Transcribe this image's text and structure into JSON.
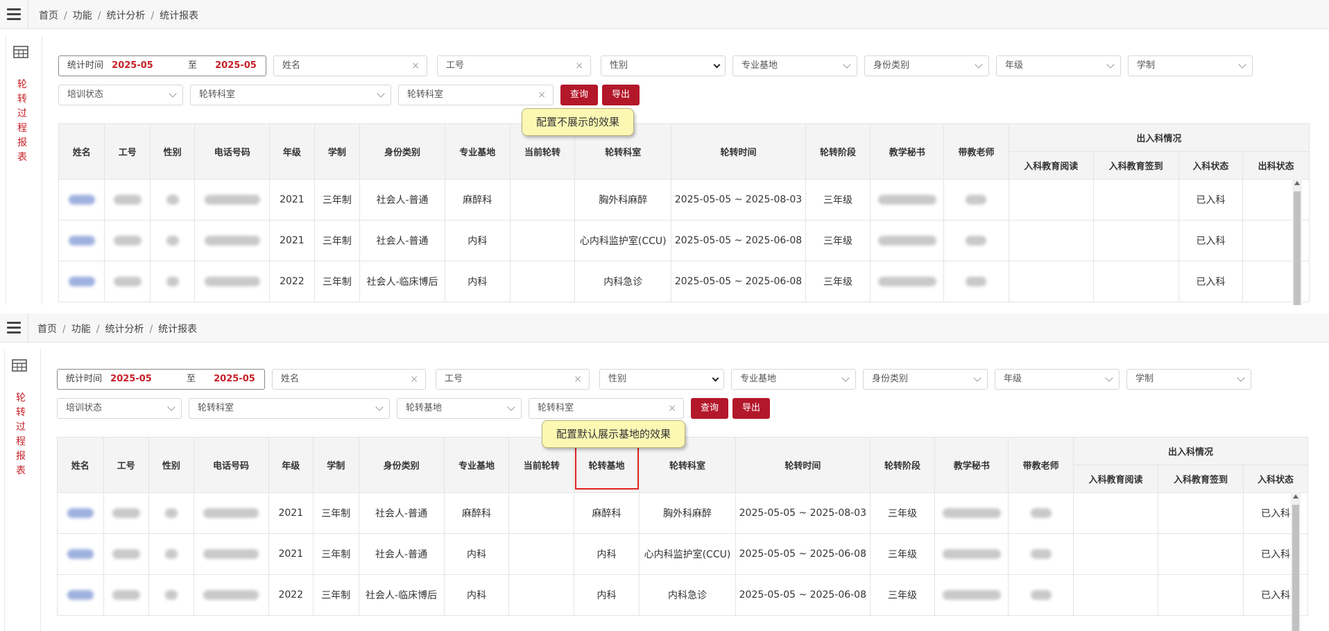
{
  "breadcrumb": [
    "首页",
    "功能",
    "统计分析",
    "统计报表"
  ],
  "side_label": "轮转过程报表",
  "filters": {
    "date_label": "统计时间",
    "date_start": "2025-05",
    "date_to": "至",
    "date_end": "2025-05",
    "name_placeholder": "姓名",
    "workno_placeholder": "工号",
    "gender_placeholder": "性别",
    "major_base": "专业基地",
    "identity": "身份类别",
    "grade": "年级",
    "edu_system": "学制",
    "train_status": "培训状态",
    "rotation_dept": "轮转科室",
    "rotation_base": "轮转基地",
    "rotation_dept_input": "轮转科室",
    "clear": "×",
    "query_button": "查询",
    "export_button": "导出"
  },
  "tooltips": {
    "top": "配置不展示的效果",
    "bottom": "配置默认展示基地的效果"
  },
  "headers": {
    "name": "姓名",
    "workno": "工号",
    "gender": "性别",
    "phone": "电话号码",
    "grade": "年级",
    "system": "学制",
    "identity": "身份类别",
    "major_base": "专业基地",
    "current": "当前轮转",
    "rot_base": "轮转基地",
    "rot_dept": "轮转科室",
    "rot_time": "轮转时间",
    "rot_stage": "轮转阶段",
    "secretary": "教学秘书",
    "teacher": "带教老师",
    "inout": "出入科情况",
    "edu_read": "入科教育阅读",
    "edu_sign": "入科教育签到",
    "in_status": "入科状态",
    "out_status": "出科状态"
  },
  "rows": [
    {
      "grade": "2021",
      "system": "三年制",
      "identity": "社会人-普通",
      "major_base": "麻醉科",
      "rot_base": "麻醉科",
      "rot_dept": "胸外科麻醉",
      "rot_time": "2025-05-05 ~ 2025-08-03",
      "rot_stage": "三年级",
      "in_status": "已入科"
    },
    {
      "grade": "2021",
      "system": "三年制",
      "identity": "社会人-普通",
      "major_base": "内科",
      "rot_base": "内科",
      "rot_dept": "心内科监护室(CCU)",
      "rot_time": "2025-05-05 ~ 2025-06-08",
      "rot_stage": "三年级",
      "in_status": "已入科"
    },
    {
      "grade": "2022",
      "system": "三年制",
      "identity": "社会人-临床博后",
      "major_base": "内科",
      "rot_base": "内科",
      "rot_dept": "内科急诊",
      "rot_time": "2025-05-05 ~ 2025-06-08",
      "rot_stage": "三年级",
      "in_status": "已入科"
    }
  ]
}
